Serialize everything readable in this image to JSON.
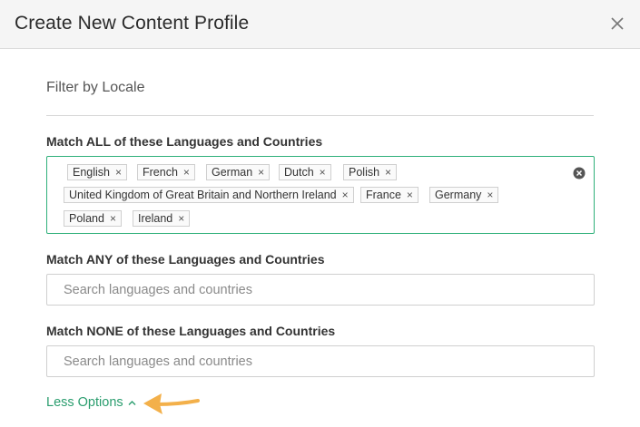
{
  "modal": {
    "title": "Create New Content Profile"
  },
  "section": {
    "title": "Filter by Locale"
  },
  "match_all": {
    "label": "Match ALL of these Languages and Countries",
    "tags": [
      "English",
      "French",
      "German",
      "Dutch",
      "Polish",
      "United Kingdom of Great Britain and Northern Ireland",
      "France",
      "Germany",
      "Poland",
      "Ireland"
    ],
    "tag_remove_glyph": "×"
  },
  "match_any": {
    "label": "Match ANY of these Languages and Countries",
    "placeholder": "Search languages and countries"
  },
  "match_none": {
    "label": "Match NONE of these Languages and Countries",
    "placeholder": "Search languages and countries"
  },
  "options_toggle": {
    "label": "Less Options"
  },
  "colors": {
    "accent_green": "#2a9d6e",
    "focus_border": "#2fb07a",
    "annotation_arrow": "#f3b04a"
  },
  "icons": {
    "close": "close-icon",
    "clear": "clear-circle-icon",
    "caret": "chevron-up-icon",
    "annotation": "arrow-icon"
  }
}
